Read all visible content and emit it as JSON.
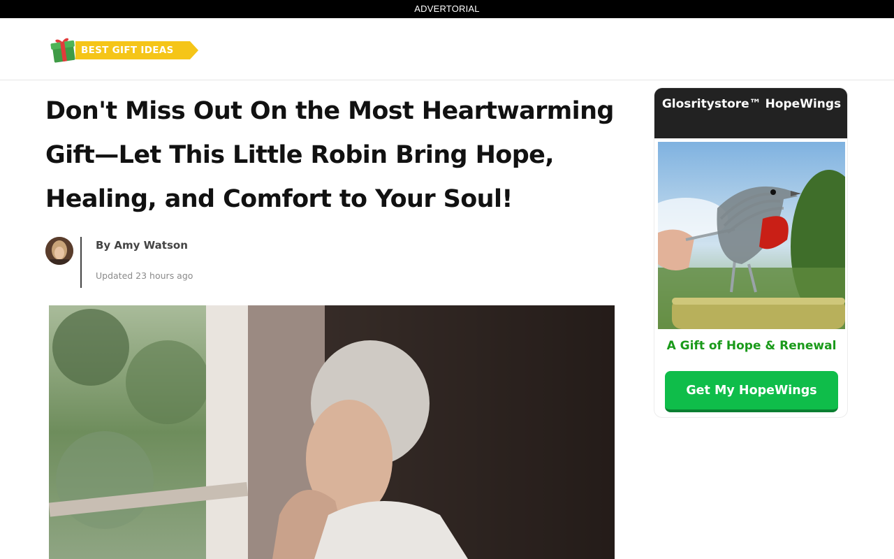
{
  "topbar": {
    "label": "ADVERTORIAL"
  },
  "header": {
    "logo_text": "BEST GIFT IDEAS"
  },
  "article": {
    "headline": "Don't Miss Out On the Most Heartwarming Gift—Let This Little Robin Bring Hope, Healing, and Comfort to Your Soul!",
    "author": "By Amy Watson",
    "updated": "Updated 23 hours ago",
    "hero_image": "elderly-woman-looking-out-window-photo"
  },
  "sidebar": {
    "card_title": "Glosritystore™ HopeWings",
    "product_image": "metal-fork-robin-sculpture-photo",
    "tagline": "A Gift of Hope & Renewal",
    "cta_label": "Get My HopeWings"
  },
  "colors": {
    "topbar_bg": "#000000",
    "card_header_bg": "#222222",
    "tagline_green": "#1a9a1a",
    "cta_green": "#0fbd4a",
    "logo_yellow": "#f5c518"
  }
}
